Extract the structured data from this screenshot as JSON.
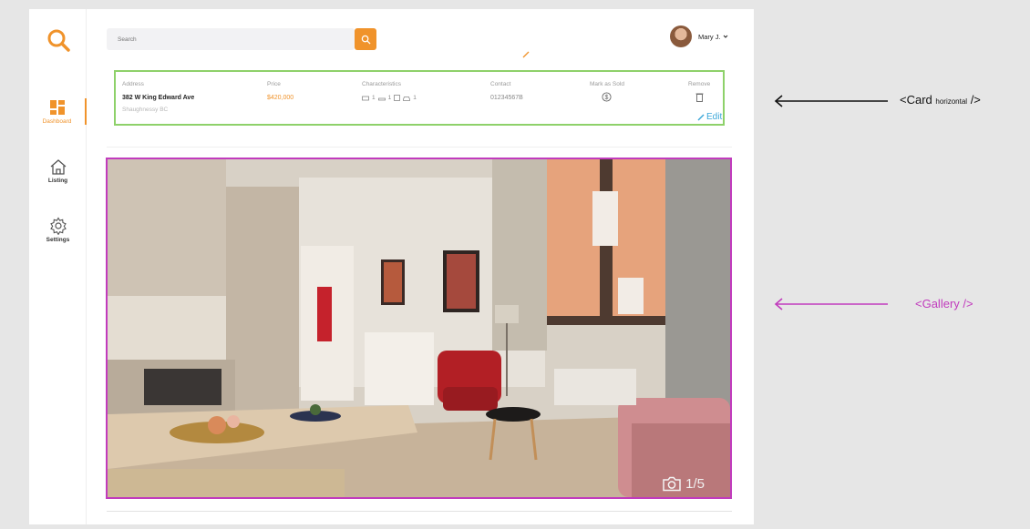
{
  "sidebar": {
    "items": [
      {
        "label": "Dashboard",
        "icon": "dashboard-icon",
        "active": true
      },
      {
        "label": "Listing",
        "icon": "home-icon",
        "active": false
      },
      {
        "label": "Settings",
        "icon": "gear-icon",
        "active": false
      }
    ]
  },
  "search": {
    "placeholder": "Search"
  },
  "user": {
    "name": "Mary J."
  },
  "card": {
    "address_header": "Address",
    "address_line": "382 W King Edward Ave",
    "address_sub": "Shaughnessy BC",
    "price_header": "Price",
    "price_value": "$420,000",
    "characteristics_header": "Characteristics",
    "beds": "1",
    "baths": "1",
    "parking": "1",
    "contact_header": "Contact",
    "contact_value": "01234567B",
    "mark_sold_header": "Mark as Sold",
    "remove_header": "Remove",
    "edit_label": "Edit"
  },
  "gallery": {
    "counter": "1/5"
  },
  "annotations": {
    "card_label_main": "<Card ",
    "card_label_small": "horizontal",
    "card_label_end": " />",
    "gallery_label": "<Gallery />"
  },
  "colors": {
    "accent": "#f0932b",
    "card_outline": "#8ed16a",
    "gallery_outline": "#c13bbd",
    "edit_link": "#3aa6d8"
  }
}
